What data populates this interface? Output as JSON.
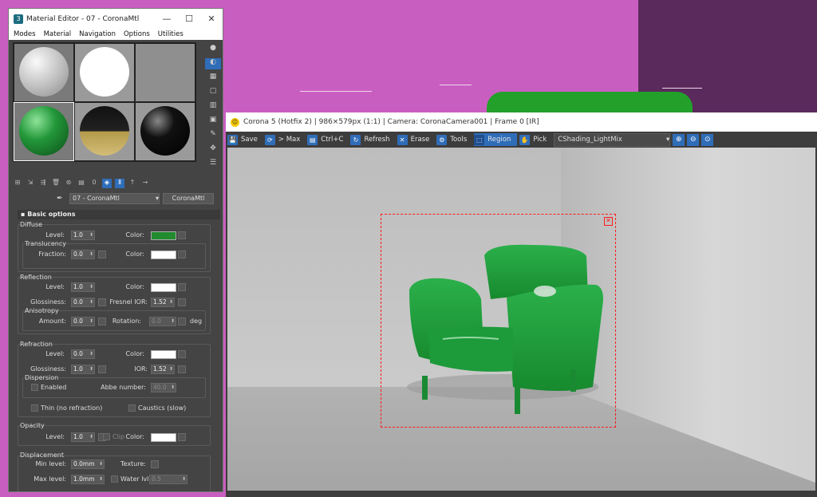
{
  "material_editor": {
    "title": "Material Editor - 07 - CoronaMtl",
    "app_icon": "3",
    "window_buttons": {
      "minimize": "—",
      "maximize": "☐",
      "close": "✕"
    },
    "menu": [
      "Modes",
      "Material",
      "Navigation",
      "Options",
      "Utilities"
    ],
    "slots": [
      {
        "name": "gray sphere",
        "color": "#cfcfcf"
      },
      {
        "name": "white sphere",
        "color": "#ffffff"
      },
      {
        "name": "empty",
        "color": "#8a8a8a"
      },
      {
        "name": "green sphere",
        "color": "#1f8f33"
      },
      {
        "name": "black gold sphere",
        "color": "#111111"
      },
      {
        "name": "black sphere",
        "color": "#0a0a0a"
      }
    ],
    "selected_material": "07 - CoronaMtl",
    "material_type": "CoronaMtl",
    "rollout_title": "Basic options",
    "diffuse": {
      "group": "Diffuse",
      "level_label": "Level:",
      "level": "1.0",
      "color_label": "Color:",
      "color": "#228b2f",
      "translucency": "Translucency",
      "fraction_label": "Fraction:",
      "fraction": "0.0",
      "trans_color_label": "Color:",
      "trans_color": "#ffffff"
    },
    "reflection": {
      "group": "Reflection",
      "level_label": "Level:",
      "level": "1.0",
      "color_label": "Color:",
      "color": "#ffffff",
      "gloss_label": "Glossiness:",
      "gloss": "0.0",
      "fresnel_label": "Fresnel IOR:",
      "fresnel": "1.52",
      "anisotropy": "Anisotropy",
      "amount_label": "Amount:",
      "amount": "0.0",
      "rotation_label": "Rotation:",
      "rotation": "0.0",
      "deg": "deg"
    },
    "refraction": {
      "group": "Refraction",
      "level_label": "Level:",
      "level": "0.0",
      "color_label": "Color:",
      "color": "#ffffff",
      "gloss_label": "Glossiness:",
      "gloss": "1.0",
      "ior_label": "IOR:",
      "ior": "1.52",
      "dispersion": "Dispersion",
      "enabled": "Enabled",
      "abbe_label": "Abbe number:",
      "abbe": "40.0",
      "thin": "Thin (no refraction)",
      "caustics": "Caustics (slow)"
    },
    "opacity": {
      "group": "Opacity",
      "level_label": "Level:",
      "level": "1.0",
      "clip": "Clip",
      "color_label": "Color:",
      "color": "#ffffff"
    },
    "displacement": {
      "group": "Displacement",
      "min_label": "Min level:",
      "min": "0.0mm",
      "texture_label": "Texture:",
      "max_label": "Max level:",
      "max": "1.0mm",
      "water_label": "Water lvl.:",
      "water": "0.5"
    }
  },
  "vfb": {
    "title": "Corona 5 (Hotfix 2) | 986×579px (1:1) | Camera: CoronaCamera001 | Frame 0 [IR]",
    "toolbar": {
      "save": "Save",
      "max": "> Max",
      "ctrlc": "Ctrl+C",
      "refresh": "Refresh",
      "erase": "Erase",
      "tools": "Tools",
      "region": "Region",
      "pick": "Pick",
      "channel": "CShading_LightMix"
    }
  }
}
